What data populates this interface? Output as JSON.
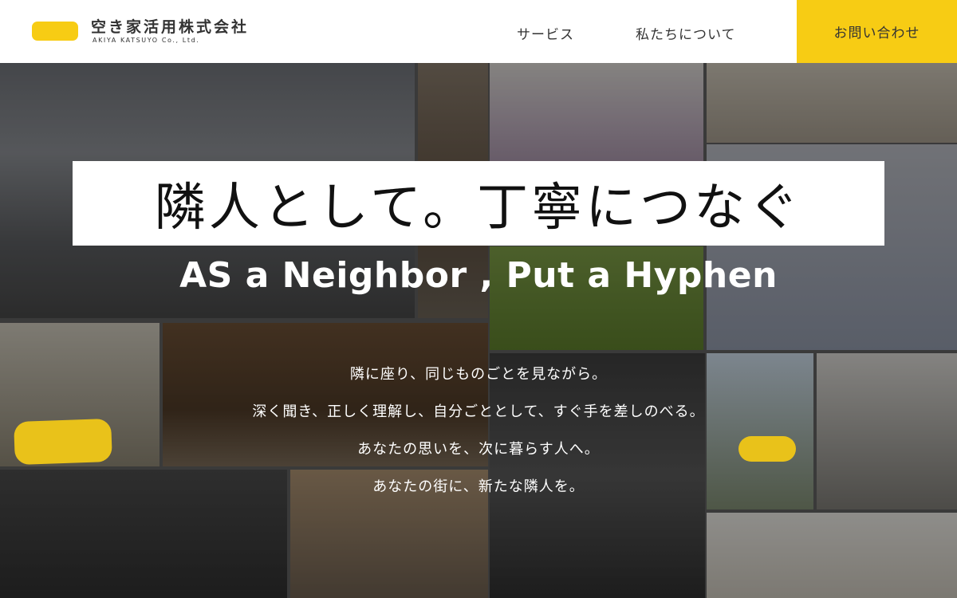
{
  "header": {
    "company_name": "空き家活用株式会社",
    "company_name_en": "AKIYA KATSUYO Co., Ltd.",
    "brand_color": "#f7cc14",
    "nav": {
      "service": "サービス",
      "about": "私たちについて",
      "contact": "お問い合わせ"
    }
  },
  "hero": {
    "headline_jp": "隣人として。丁寧につなぐ",
    "headline_en": "AS a Neighbor , Put a Hyphen",
    "lines": [
      "隣に座り、同じものごとを見ながら。",
      "深く聞き、正しく理解し、自分ごととして、すぐ手を差しのべる。",
      "あなたの思いを、次に暮らす人へ。",
      "あなたの街に、新たな隣人を。"
    ],
    "background_icon": "photo-collage"
  }
}
